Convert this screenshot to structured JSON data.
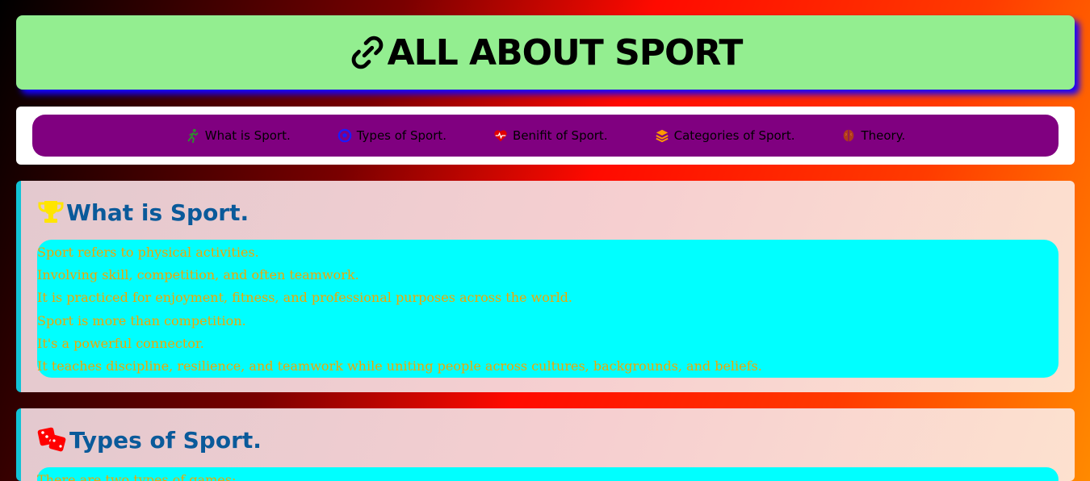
{
  "header": {
    "title": "ALL ABOUT SPORT",
    "icon": "link-icon"
  },
  "nav": {
    "items": [
      {
        "label": "What is Sport.",
        "icon": "running-person-icon",
        "color": "#2e8b2e"
      },
      {
        "label": "Types of Sport.",
        "icon": "soccer-ball-icon",
        "color": "#1a1aff"
      },
      {
        "label": "Benifit of Sport.",
        "icon": "heartbeat-icon",
        "color": "#e00000"
      },
      {
        "label": "Categories of Sport.",
        "icon": "layers-icon",
        "color": "#ff9a00"
      },
      {
        "label": "Theory.",
        "icon": "brain-icon",
        "color": "#b03a1a"
      }
    ]
  },
  "sections": [
    {
      "title": "What is Sport.",
      "icon": "trophy-icon",
      "lines": [
        "Sport refers to physical activities.",
        "Involving skill, competition, and often teamwork.",
        "It is practiced for enjoyment, fitness, and professional purposes across the world.",
        "Sport is more than competition.",
        "It's a powerful connector.",
        "It teaches discipline, resilience, and teamwork while uniting people across cultures, backgrounds, and beliefs."
      ]
    },
    {
      "title": "Types of Sport.",
      "icon": "dice-icon",
      "lines": [
        "There are two types of games:"
      ]
    }
  ],
  "colors": {
    "header_bg": "#93ee90",
    "nav_bg": "#800080",
    "section_title": "#0a5a9a",
    "content_bg": "#00ffff",
    "content_text": "#f2a500"
  }
}
